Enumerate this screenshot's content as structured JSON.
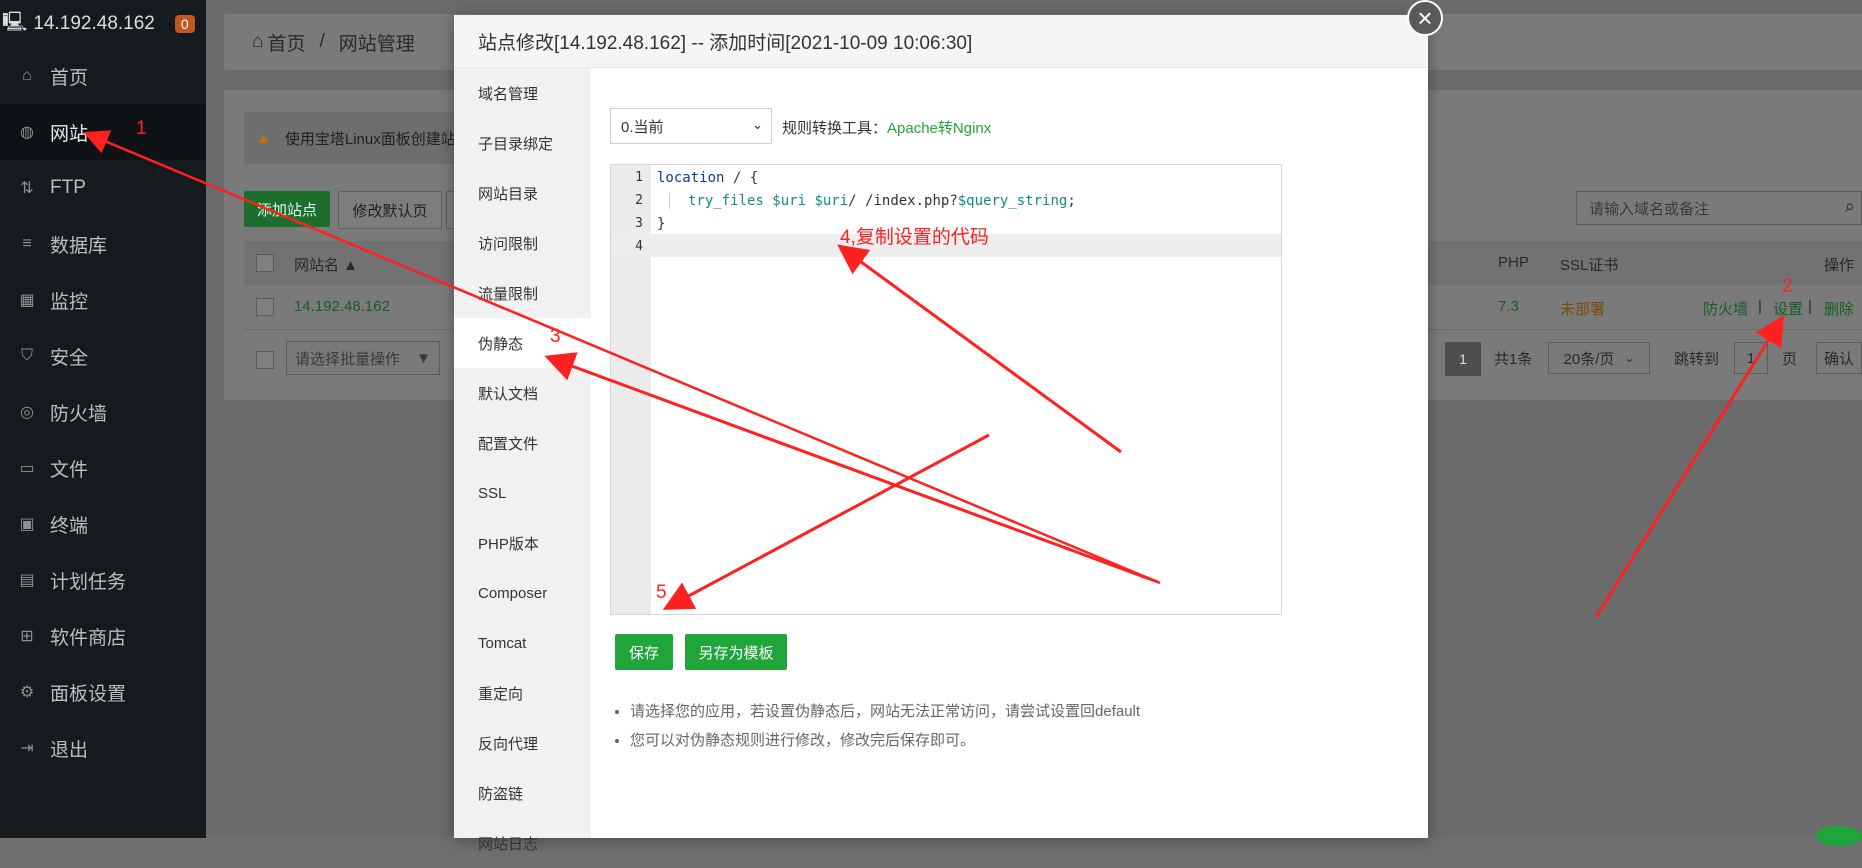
{
  "sidebar": {
    "ip": "14.192.48.162",
    "badge": "0",
    "items": [
      {
        "label": "首页",
        "icon": "home-icon"
      },
      {
        "label": "网站",
        "icon": "globe-icon"
      },
      {
        "label": "FTP",
        "icon": "ftp-icon"
      },
      {
        "label": "数据库",
        "icon": "database-icon"
      },
      {
        "label": "监控",
        "icon": "monitor-icon"
      },
      {
        "label": "安全",
        "icon": "shield-icon"
      },
      {
        "label": "防火墙",
        "icon": "firewall-icon"
      },
      {
        "label": "文件",
        "icon": "folder-icon"
      },
      {
        "label": "终端",
        "icon": "terminal-icon"
      },
      {
        "label": "计划任务",
        "icon": "calendar-icon"
      },
      {
        "label": "软件商店",
        "icon": "apps-icon"
      },
      {
        "label": "面板设置",
        "icon": "gear-icon"
      },
      {
        "label": "退出",
        "icon": "logout-icon"
      }
    ]
  },
  "breadcrumb": {
    "home": "首页",
    "sep": "/",
    "current": "网站管理"
  },
  "page": {
    "warning": "使用宝塔Linux面板创建站",
    "add_site": "添加站点",
    "modify_default": "修改默认页",
    "search_placeholder": "请输入域名或备注",
    "table": {
      "headers": {
        "name": "网站名 ▲",
        "php": "PHP",
        "ssl": "SSL证书",
        "ops": "操作"
      },
      "row": {
        "name": "14.192.48.162",
        "php": "7.3",
        "ssl": "未部署",
        "firewall": "防火墙",
        "settings": "设置",
        "delete": "删除",
        "sep": "|"
      }
    },
    "batch_placeholder": "请选择批量操作",
    "pager": {
      "current": "1",
      "total": "共1条",
      "per_page": "20条/页",
      "jump": "跳转到",
      "page_input": "1",
      "page_unit": "页",
      "confirm": "确认"
    }
  },
  "modal": {
    "title": "站点修改[14.192.48.162] -- 添加时间[2021-10-09 10:06:30]",
    "nav": [
      "域名管理",
      "子目录绑定",
      "网站目录",
      "访问限制",
      "流量限制",
      "伪静态",
      "默认文档",
      "配置文件",
      "SSL",
      "PHP版本",
      "Composer",
      "Tomcat",
      "重定向",
      "反向代理",
      "防盗链",
      "网站日志"
    ],
    "select_value": "0.当前",
    "tool_label": "规则转换工具：",
    "tool_link": "Apache转Nginx",
    "code_lines": [
      {
        "num": "1",
        "tokens": [
          {
            "t": "location",
            "c": "kw"
          },
          {
            "t": " / {",
            "c": ""
          }
        ]
      },
      {
        "num": "2",
        "tokens": [
          {
            "t": "try_files",
            "c": "fn"
          },
          {
            "t": " ",
            "c": ""
          },
          {
            "t": "$uri",
            "c": "var"
          },
          {
            "t": " ",
            "c": ""
          },
          {
            "t": "$uri",
            "c": "var"
          },
          {
            "t": "/ /index.php?",
            "c": ""
          },
          {
            "t": "$query_string",
            "c": "var"
          },
          {
            "t": ";",
            "c": ""
          }
        ]
      },
      {
        "num": "3",
        "tokens": [
          {
            "t": "}",
            "c": ""
          }
        ]
      },
      {
        "num": "4",
        "tokens": []
      }
    ],
    "save": "保存",
    "save_template": "另存为模板",
    "tips": [
      "请选择您的应用，若设置伪静态后，网站无法正常访问，请尝试设置回default",
      "您可以对伪静态规则进行修改，修改完后保存即可。"
    ]
  },
  "annotations": {
    "one": "1",
    "two": "2",
    "three": "3",
    "four": "4,复制设置的代码",
    "five": "5",
    "color": "#ff2020"
  },
  "colors": {
    "accent": "#20a53a",
    "sidebar_bg": "#151a1f",
    "warning_orange": "#c2561f"
  }
}
